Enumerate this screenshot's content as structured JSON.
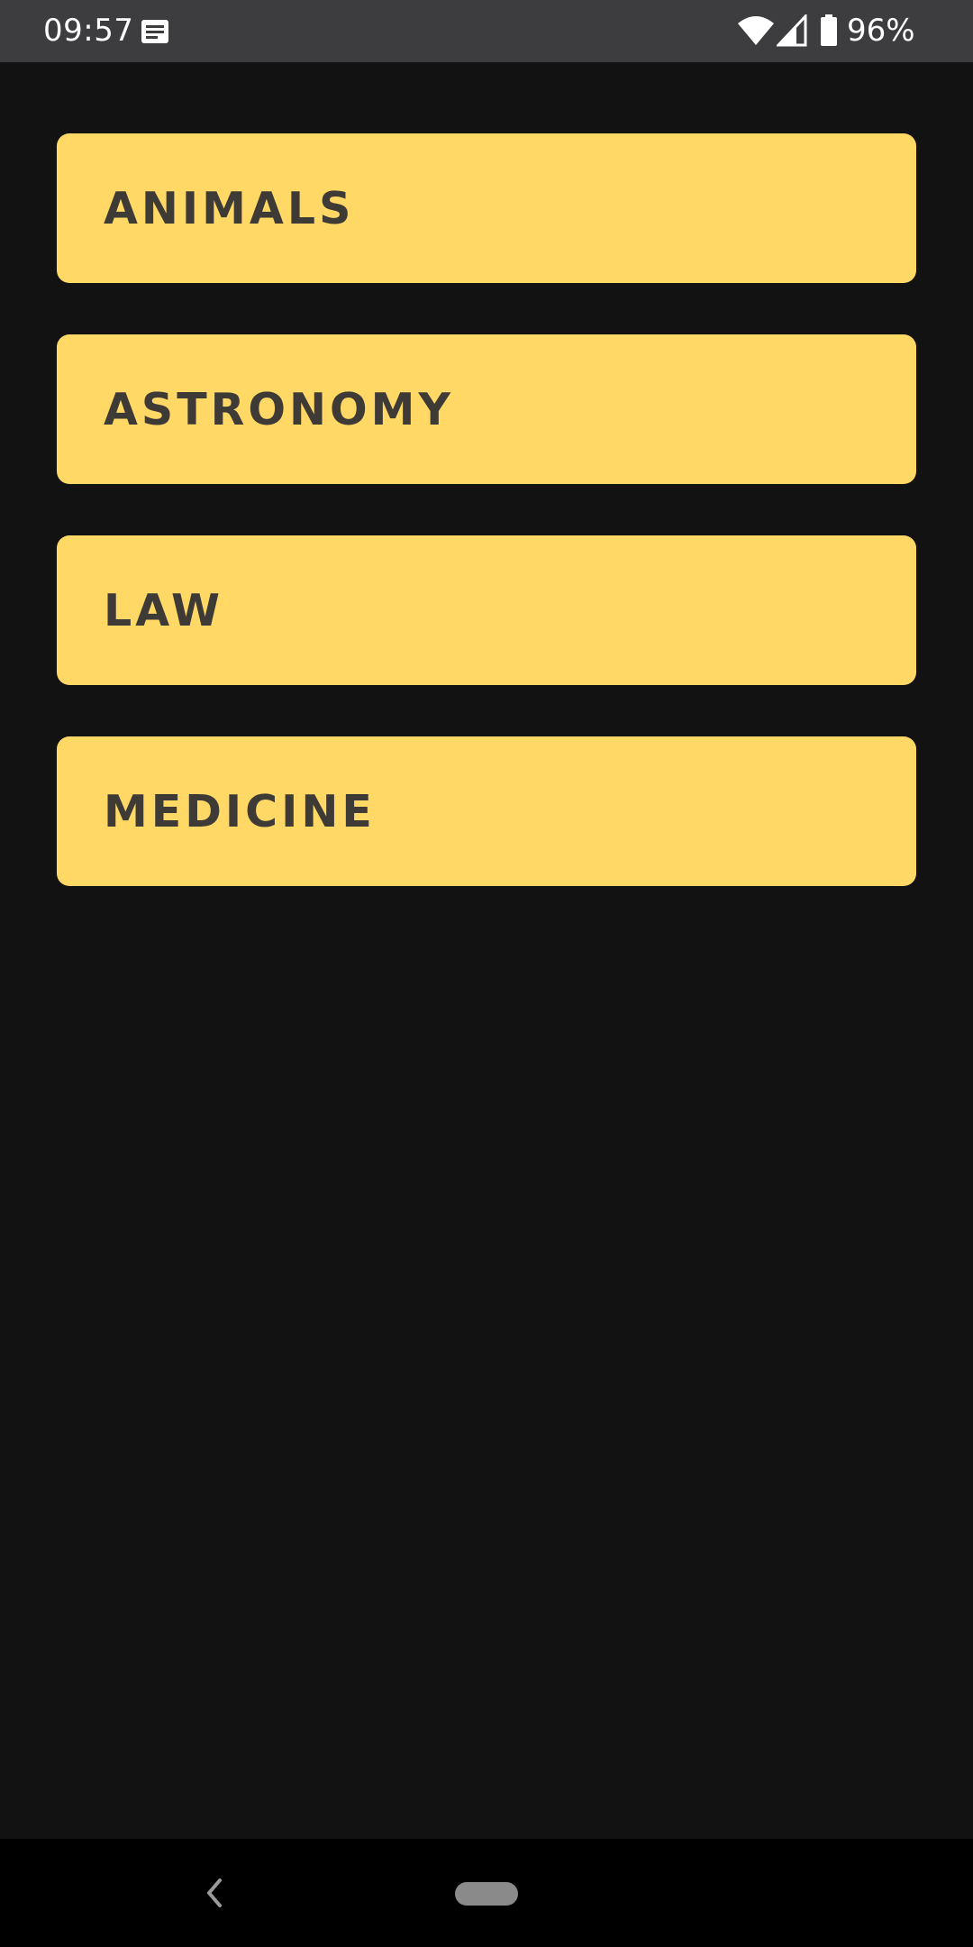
{
  "status_bar": {
    "time": "09:57",
    "battery": "96%",
    "icons": [
      "notification-icon",
      "wifi-icon",
      "signal-icon",
      "battery-icon"
    ]
  },
  "categories": [
    {
      "label": "ANIMALS"
    },
    {
      "label": "ASTRONOMY"
    },
    {
      "label": "LAW"
    },
    {
      "label": "MEDICINE"
    }
  ],
  "nav_bar": {
    "icons": [
      "back-icon",
      "home-pill-icon"
    ]
  },
  "colors": {
    "background": "#121212",
    "status_bar": "#3d3c3f",
    "card": "#ffd866",
    "card_text": "#3e3b36",
    "nav_bar": "#000000"
  }
}
